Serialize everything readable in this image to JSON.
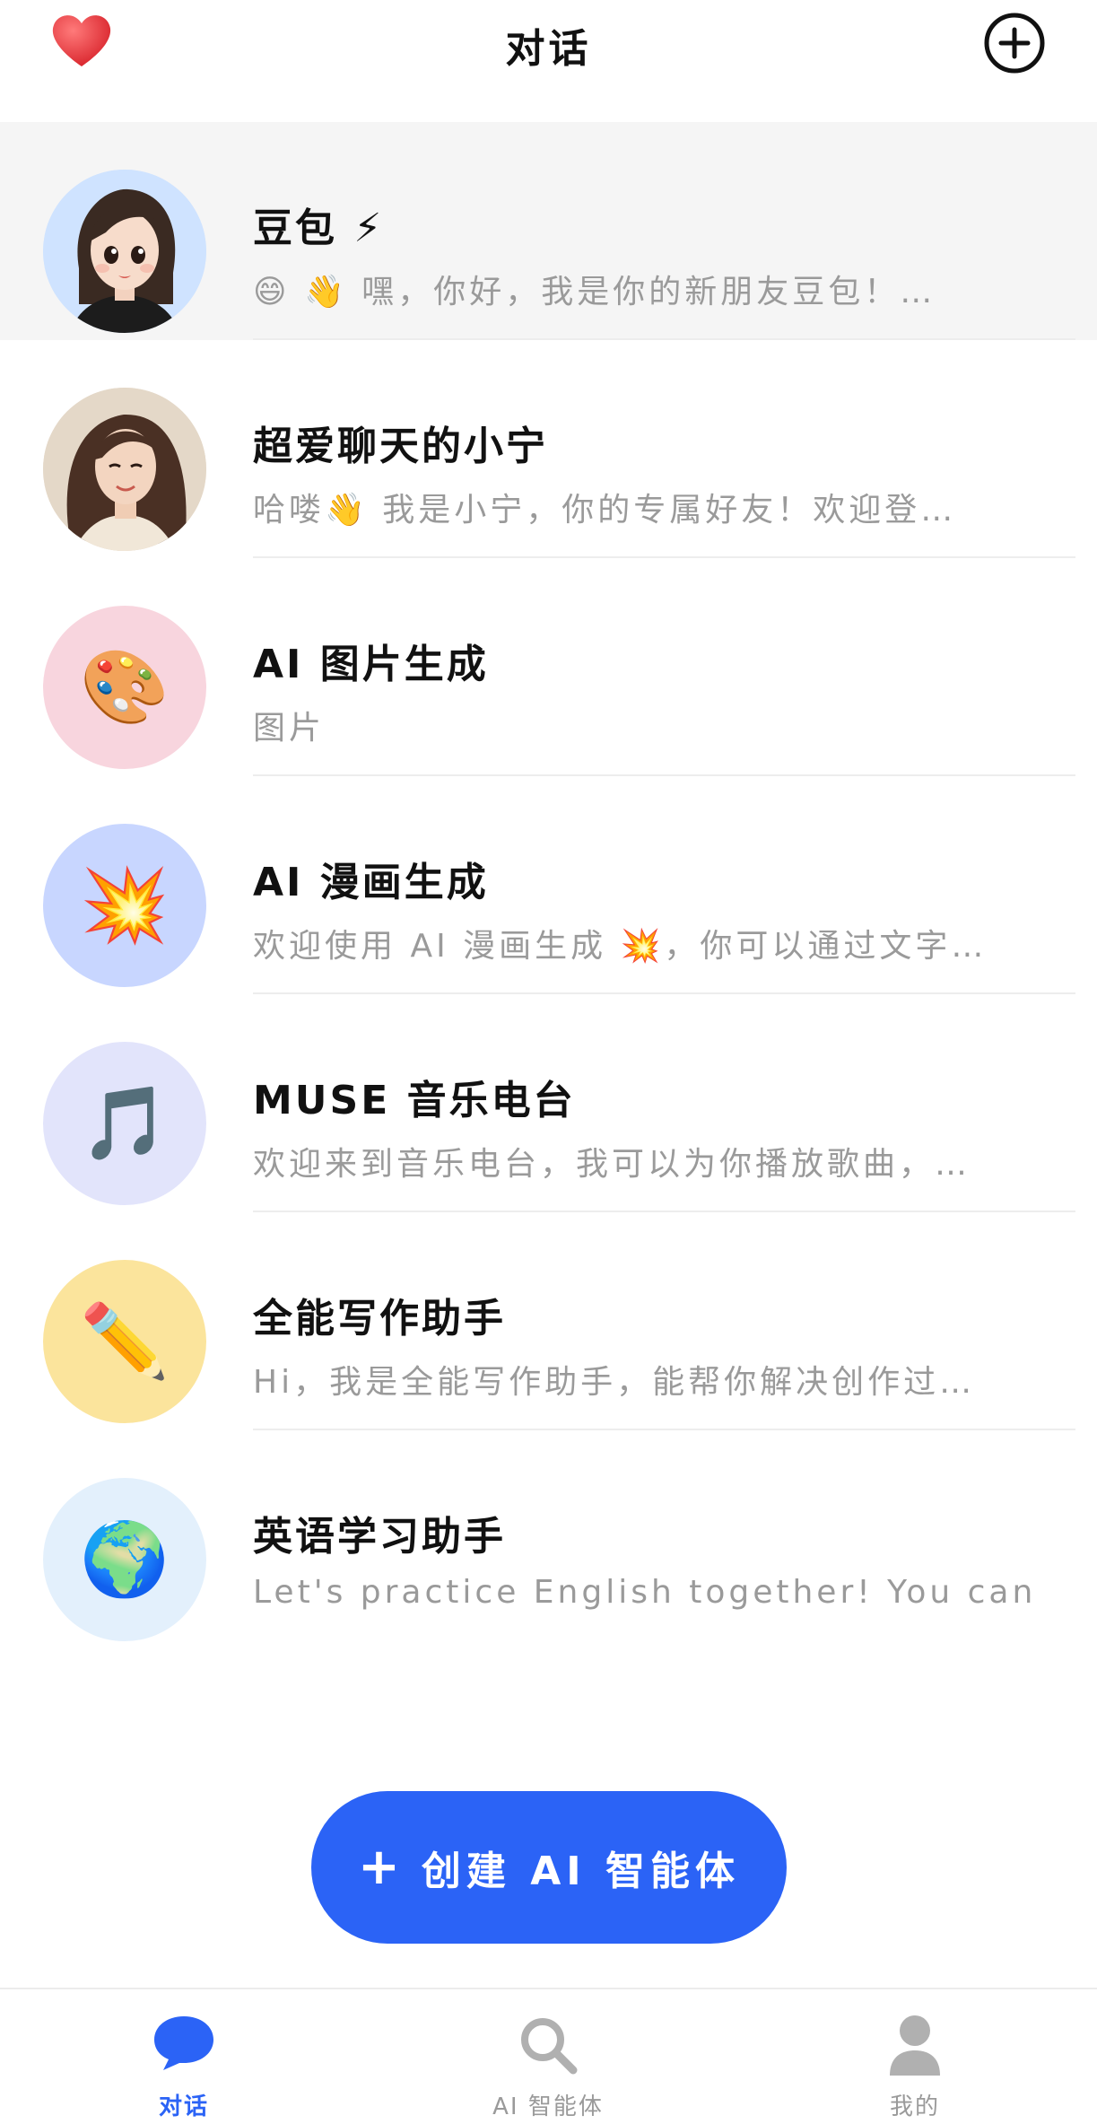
{
  "header": {
    "title": "对话",
    "left_icon": "heart-icon",
    "right_icon": "plus-circle-icon"
  },
  "conversations": [
    {
      "name": "豆包 ⚡",
      "preview": "😄 👋 嘿，你好，我是你的新朋友豆包！…",
      "avatar": "doubao-avatar",
      "avatar_bg": "#cfe3ff",
      "active": true
    },
    {
      "name": "超爱聊天的小宁",
      "preview": "哈喽👋 我是小宁，你的专属好友！欢迎登…",
      "avatar": "xiaoning-avatar",
      "avatar_bg": "#e9dccd",
      "active": false
    },
    {
      "name": "AI 图片生成",
      "preview": "图片",
      "avatar": "🎨",
      "avatar_bg": "#f8d5de",
      "active": false
    },
    {
      "name": "AI 漫画生成",
      "preview": "欢迎使用 AI 漫画生成 💥，你可以通过文字…",
      "avatar": "💥",
      "avatar_bg": "#c8d6ff",
      "active": false
    },
    {
      "name": "MUSE 音乐电台",
      "preview": "欢迎来到音乐电台，我可以为你播放歌曲，…",
      "avatar": "🎵",
      "avatar_bg": "#e2e4fb",
      "active": false
    },
    {
      "name": "全能写作助手",
      "preview": "Hi，我是全能写作助手，能帮你解决创作过…",
      "avatar": "✏️",
      "avatar_bg": "#fbe49c",
      "active": false
    },
    {
      "name": "英语学习助手",
      "preview": "Let's practice English together! You can try to a…",
      "avatar": "🌍",
      "avatar_bg": "#e3f0fc",
      "active": false
    }
  ],
  "create_button": {
    "label": "创建 AI 智能体",
    "icon": "plus-icon",
    "color": "#2b63f6"
  },
  "bottom_nav": [
    {
      "label": "对话",
      "icon": "chat-bubble-icon",
      "active": true
    },
    {
      "label": "AI 智能体",
      "icon": "search-icon",
      "active": false
    },
    {
      "label": "我的",
      "icon": "person-icon",
      "active": false
    }
  ],
  "colors": {
    "accent": "#2b63f6",
    "heart": "#e8343a",
    "preview_text": "#9a9a9a"
  }
}
